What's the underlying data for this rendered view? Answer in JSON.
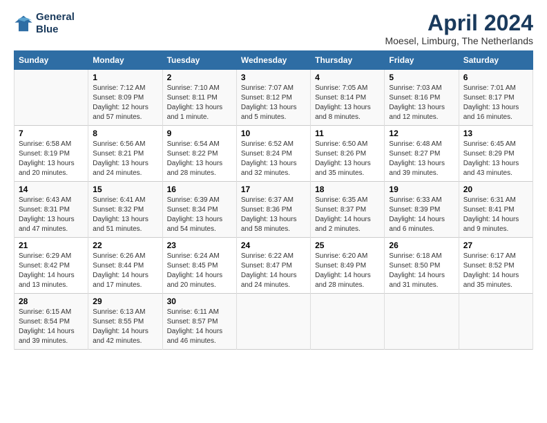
{
  "logo": {
    "line1": "General",
    "line2": "Blue"
  },
  "title": "April 2024",
  "subtitle": "Moesel, Limburg, The Netherlands",
  "days_of_week": [
    "Sunday",
    "Monday",
    "Tuesday",
    "Wednesday",
    "Thursday",
    "Friday",
    "Saturday"
  ],
  "weeks": [
    [
      {
        "day": "",
        "info": ""
      },
      {
        "day": "1",
        "info": "Sunrise: 7:12 AM\nSunset: 8:09 PM\nDaylight: 12 hours\nand 57 minutes."
      },
      {
        "day": "2",
        "info": "Sunrise: 7:10 AM\nSunset: 8:11 PM\nDaylight: 13 hours\nand 1 minute."
      },
      {
        "day": "3",
        "info": "Sunrise: 7:07 AM\nSunset: 8:12 PM\nDaylight: 13 hours\nand 5 minutes."
      },
      {
        "day": "4",
        "info": "Sunrise: 7:05 AM\nSunset: 8:14 PM\nDaylight: 13 hours\nand 8 minutes."
      },
      {
        "day": "5",
        "info": "Sunrise: 7:03 AM\nSunset: 8:16 PM\nDaylight: 13 hours\nand 12 minutes."
      },
      {
        "day": "6",
        "info": "Sunrise: 7:01 AM\nSunset: 8:17 PM\nDaylight: 13 hours\nand 16 minutes."
      }
    ],
    [
      {
        "day": "7",
        "info": "Sunrise: 6:58 AM\nSunset: 8:19 PM\nDaylight: 13 hours\nand 20 minutes."
      },
      {
        "day": "8",
        "info": "Sunrise: 6:56 AM\nSunset: 8:21 PM\nDaylight: 13 hours\nand 24 minutes."
      },
      {
        "day": "9",
        "info": "Sunrise: 6:54 AM\nSunset: 8:22 PM\nDaylight: 13 hours\nand 28 minutes."
      },
      {
        "day": "10",
        "info": "Sunrise: 6:52 AM\nSunset: 8:24 PM\nDaylight: 13 hours\nand 32 minutes."
      },
      {
        "day": "11",
        "info": "Sunrise: 6:50 AM\nSunset: 8:26 PM\nDaylight: 13 hours\nand 35 minutes."
      },
      {
        "day": "12",
        "info": "Sunrise: 6:48 AM\nSunset: 8:27 PM\nDaylight: 13 hours\nand 39 minutes."
      },
      {
        "day": "13",
        "info": "Sunrise: 6:45 AM\nSunset: 8:29 PM\nDaylight: 13 hours\nand 43 minutes."
      }
    ],
    [
      {
        "day": "14",
        "info": "Sunrise: 6:43 AM\nSunset: 8:31 PM\nDaylight: 13 hours\nand 47 minutes."
      },
      {
        "day": "15",
        "info": "Sunrise: 6:41 AM\nSunset: 8:32 PM\nDaylight: 13 hours\nand 51 minutes."
      },
      {
        "day": "16",
        "info": "Sunrise: 6:39 AM\nSunset: 8:34 PM\nDaylight: 13 hours\nand 54 minutes."
      },
      {
        "day": "17",
        "info": "Sunrise: 6:37 AM\nSunset: 8:36 PM\nDaylight: 13 hours\nand 58 minutes."
      },
      {
        "day": "18",
        "info": "Sunrise: 6:35 AM\nSunset: 8:37 PM\nDaylight: 14 hours\nand 2 minutes."
      },
      {
        "day": "19",
        "info": "Sunrise: 6:33 AM\nSunset: 8:39 PM\nDaylight: 14 hours\nand 6 minutes."
      },
      {
        "day": "20",
        "info": "Sunrise: 6:31 AM\nSunset: 8:41 PM\nDaylight: 14 hours\nand 9 minutes."
      }
    ],
    [
      {
        "day": "21",
        "info": "Sunrise: 6:29 AM\nSunset: 8:42 PM\nDaylight: 14 hours\nand 13 minutes."
      },
      {
        "day": "22",
        "info": "Sunrise: 6:26 AM\nSunset: 8:44 PM\nDaylight: 14 hours\nand 17 minutes."
      },
      {
        "day": "23",
        "info": "Sunrise: 6:24 AM\nSunset: 8:45 PM\nDaylight: 14 hours\nand 20 minutes."
      },
      {
        "day": "24",
        "info": "Sunrise: 6:22 AM\nSunset: 8:47 PM\nDaylight: 14 hours\nand 24 minutes."
      },
      {
        "day": "25",
        "info": "Sunrise: 6:20 AM\nSunset: 8:49 PM\nDaylight: 14 hours\nand 28 minutes."
      },
      {
        "day": "26",
        "info": "Sunrise: 6:18 AM\nSunset: 8:50 PM\nDaylight: 14 hours\nand 31 minutes."
      },
      {
        "day": "27",
        "info": "Sunrise: 6:17 AM\nSunset: 8:52 PM\nDaylight: 14 hours\nand 35 minutes."
      }
    ],
    [
      {
        "day": "28",
        "info": "Sunrise: 6:15 AM\nSunset: 8:54 PM\nDaylight: 14 hours\nand 39 minutes."
      },
      {
        "day": "29",
        "info": "Sunrise: 6:13 AM\nSunset: 8:55 PM\nDaylight: 14 hours\nand 42 minutes."
      },
      {
        "day": "30",
        "info": "Sunrise: 6:11 AM\nSunset: 8:57 PM\nDaylight: 14 hours\nand 46 minutes."
      },
      {
        "day": "",
        "info": ""
      },
      {
        "day": "",
        "info": ""
      },
      {
        "day": "",
        "info": ""
      },
      {
        "day": "",
        "info": ""
      }
    ]
  ]
}
